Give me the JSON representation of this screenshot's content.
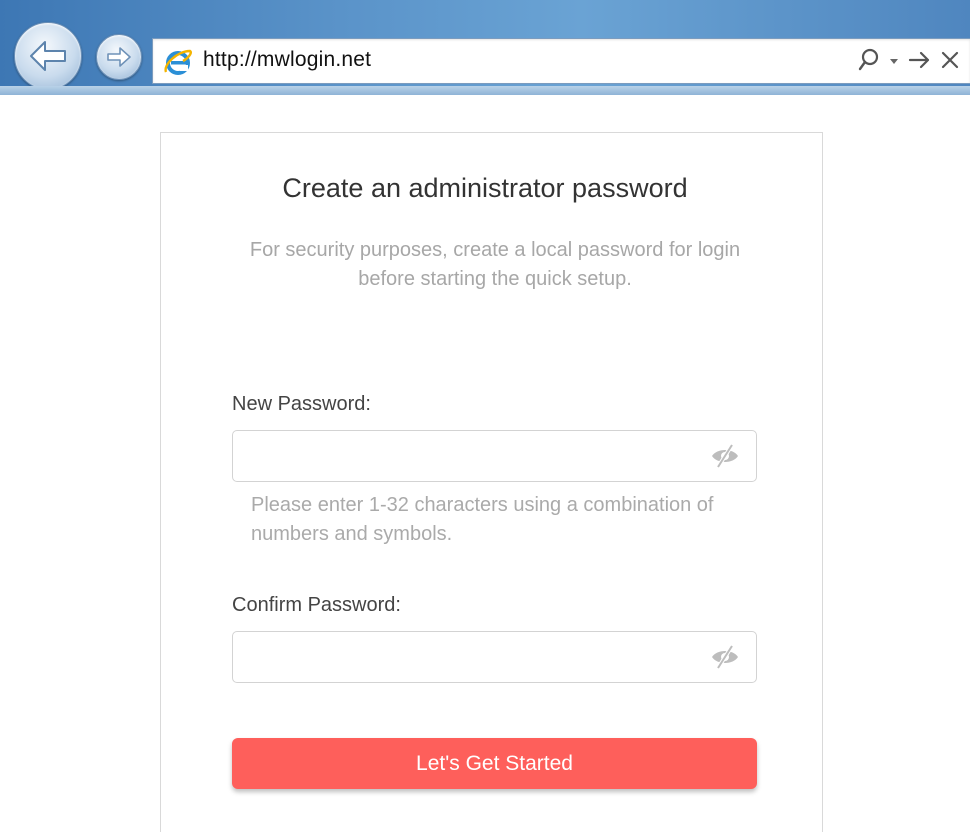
{
  "browser": {
    "url": "http://mwlogin.net",
    "back_icon": "back-arrow-icon",
    "forward_icon": "forward-arrow-icon",
    "page_icon": "internet-explorer-icon",
    "search_icon": "search-icon",
    "dropdown_icon": "dropdown-arrow-icon",
    "go_icon": "go-arrow-icon",
    "stop_icon": "close-icon"
  },
  "setup": {
    "title": "Create an administrator password",
    "subtitle": "For security purposes, create a local password for login before starting the quick setup.",
    "new_password": {
      "label": "New Password:",
      "value": "",
      "visibility_icon": "eye-slash-icon"
    },
    "hint": "Please enter 1-32 characters using a combination of numbers and symbols.",
    "confirm_password": {
      "label": "Confirm Password:",
      "value": "",
      "visibility_icon": "eye-slash-icon"
    },
    "submit_label": "Let's Get Started"
  },
  "colors": {
    "accent": "#fe5f5b",
    "title_text": "#333333",
    "muted_text": "#a7a7a7",
    "chrome_blue": "#4f86bf"
  }
}
